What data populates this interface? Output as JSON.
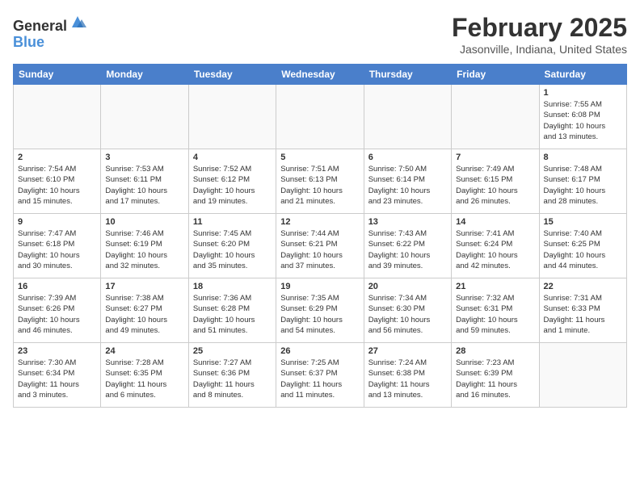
{
  "header": {
    "logo_line1": "General",
    "logo_line2": "Blue",
    "month_title": "February 2025",
    "location": "Jasonville, Indiana, United States"
  },
  "days_of_week": [
    "Sunday",
    "Monday",
    "Tuesday",
    "Wednesday",
    "Thursday",
    "Friday",
    "Saturday"
  ],
  "weeks": [
    [
      {
        "day": "",
        "info": ""
      },
      {
        "day": "",
        "info": ""
      },
      {
        "day": "",
        "info": ""
      },
      {
        "day": "",
        "info": ""
      },
      {
        "day": "",
        "info": ""
      },
      {
        "day": "",
        "info": ""
      },
      {
        "day": "1",
        "info": "Sunrise: 7:55 AM\nSunset: 6:08 PM\nDaylight: 10 hours\nand 13 minutes."
      }
    ],
    [
      {
        "day": "2",
        "info": "Sunrise: 7:54 AM\nSunset: 6:10 PM\nDaylight: 10 hours\nand 15 minutes."
      },
      {
        "day": "3",
        "info": "Sunrise: 7:53 AM\nSunset: 6:11 PM\nDaylight: 10 hours\nand 17 minutes."
      },
      {
        "day": "4",
        "info": "Sunrise: 7:52 AM\nSunset: 6:12 PM\nDaylight: 10 hours\nand 19 minutes."
      },
      {
        "day": "5",
        "info": "Sunrise: 7:51 AM\nSunset: 6:13 PM\nDaylight: 10 hours\nand 21 minutes."
      },
      {
        "day": "6",
        "info": "Sunrise: 7:50 AM\nSunset: 6:14 PM\nDaylight: 10 hours\nand 23 minutes."
      },
      {
        "day": "7",
        "info": "Sunrise: 7:49 AM\nSunset: 6:15 PM\nDaylight: 10 hours\nand 26 minutes."
      },
      {
        "day": "8",
        "info": "Sunrise: 7:48 AM\nSunset: 6:17 PM\nDaylight: 10 hours\nand 28 minutes."
      }
    ],
    [
      {
        "day": "9",
        "info": "Sunrise: 7:47 AM\nSunset: 6:18 PM\nDaylight: 10 hours\nand 30 minutes."
      },
      {
        "day": "10",
        "info": "Sunrise: 7:46 AM\nSunset: 6:19 PM\nDaylight: 10 hours\nand 32 minutes."
      },
      {
        "day": "11",
        "info": "Sunrise: 7:45 AM\nSunset: 6:20 PM\nDaylight: 10 hours\nand 35 minutes."
      },
      {
        "day": "12",
        "info": "Sunrise: 7:44 AM\nSunset: 6:21 PM\nDaylight: 10 hours\nand 37 minutes."
      },
      {
        "day": "13",
        "info": "Sunrise: 7:43 AM\nSunset: 6:22 PM\nDaylight: 10 hours\nand 39 minutes."
      },
      {
        "day": "14",
        "info": "Sunrise: 7:41 AM\nSunset: 6:24 PM\nDaylight: 10 hours\nand 42 minutes."
      },
      {
        "day": "15",
        "info": "Sunrise: 7:40 AM\nSunset: 6:25 PM\nDaylight: 10 hours\nand 44 minutes."
      }
    ],
    [
      {
        "day": "16",
        "info": "Sunrise: 7:39 AM\nSunset: 6:26 PM\nDaylight: 10 hours\nand 46 minutes."
      },
      {
        "day": "17",
        "info": "Sunrise: 7:38 AM\nSunset: 6:27 PM\nDaylight: 10 hours\nand 49 minutes."
      },
      {
        "day": "18",
        "info": "Sunrise: 7:36 AM\nSunset: 6:28 PM\nDaylight: 10 hours\nand 51 minutes."
      },
      {
        "day": "19",
        "info": "Sunrise: 7:35 AM\nSunset: 6:29 PM\nDaylight: 10 hours\nand 54 minutes."
      },
      {
        "day": "20",
        "info": "Sunrise: 7:34 AM\nSunset: 6:30 PM\nDaylight: 10 hours\nand 56 minutes."
      },
      {
        "day": "21",
        "info": "Sunrise: 7:32 AM\nSunset: 6:31 PM\nDaylight: 10 hours\nand 59 minutes."
      },
      {
        "day": "22",
        "info": "Sunrise: 7:31 AM\nSunset: 6:33 PM\nDaylight: 11 hours\nand 1 minute."
      }
    ],
    [
      {
        "day": "23",
        "info": "Sunrise: 7:30 AM\nSunset: 6:34 PM\nDaylight: 11 hours\nand 3 minutes."
      },
      {
        "day": "24",
        "info": "Sunrise: 7:28 AM\nSunset: 6:35 PM\nDaylight: 11 hours\nand 6 minutes."
      },
      {
        "day": "25",
        "info": "Sunrise: 7:27 AM\nSunset: 6:36 PM\nDaylight: 11 hours\nand 8 minutes."
      },
      {
        "day": "26",
        "info": "Sunrise: 7:25 AM\nSunset: 6:37 PM\nDaylight: 11 hours\nand 11 minutes."
      },
      {
        "day": "27",
        "info": "Sunrise: 7:24 AM\nSunset: 6:38 PM\nDaylight: 11 hours\nand 13 minutes."
      },
      {
        "day": "28",
        "info": "Sunrise: 7:23 AM\nSunset: 6:39 PM\nDaylight: 11 hours\nand 16 minutes."
      },
      {
        "day": "",
        "info": ""
      }
    ]
  ]
}
